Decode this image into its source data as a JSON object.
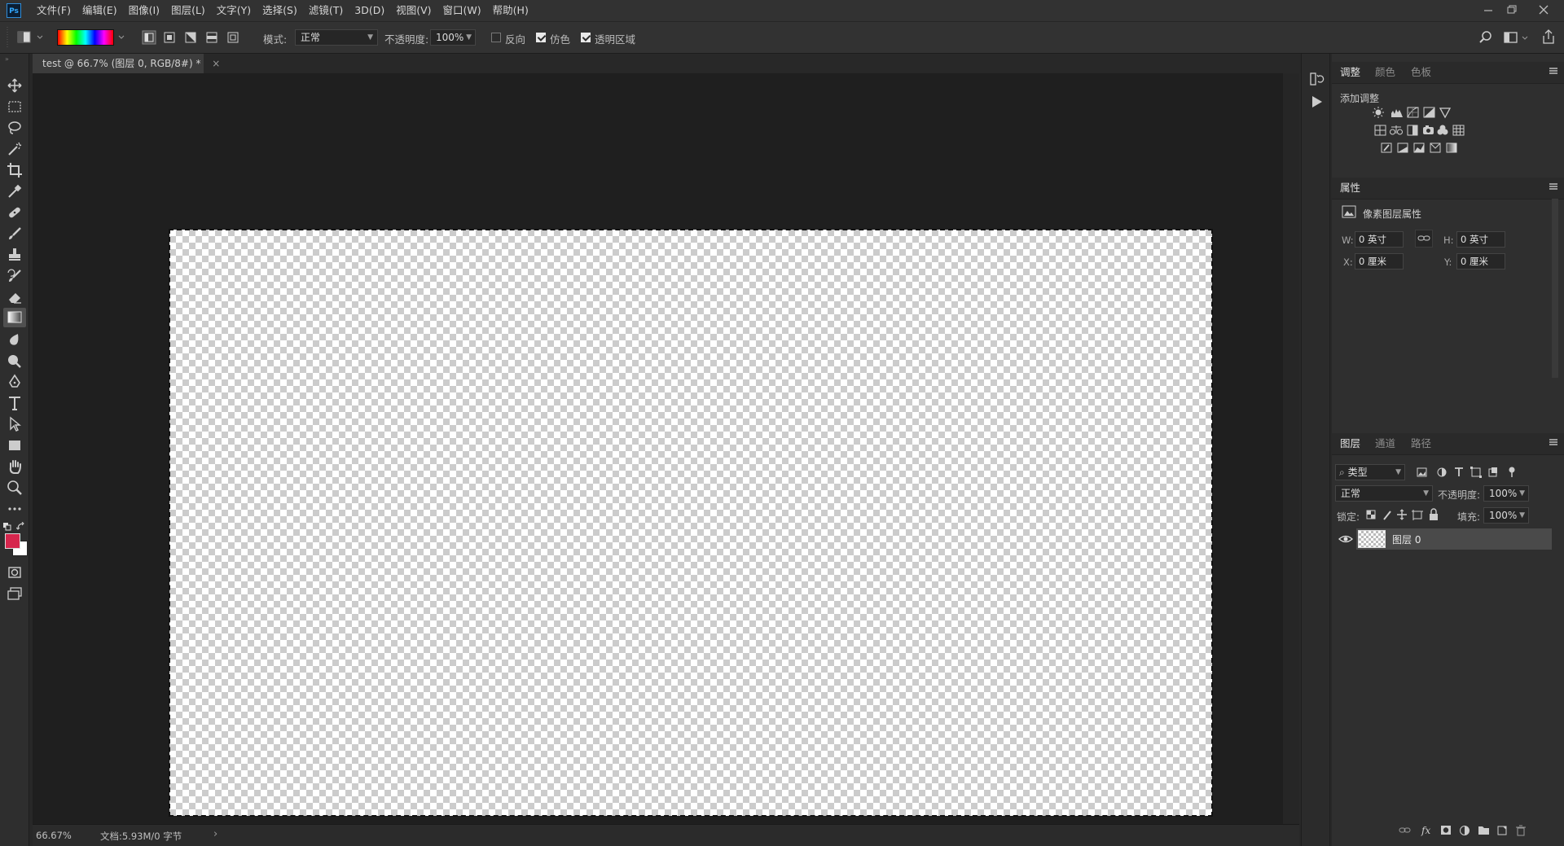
{
  "app": {
    "logo": "Ps",
    "menu": [
      "文件(F)",
      "编辑(E)",
      "图像(I)",
      "图层(L)",
      "文字(Y)",
      "选择(S)",
      "滤镜(T)",
      "3D(D)",
      "视图(V)",
      "窗口(W)",
      "帮助(H)"
    ]
  },
  "options_bar": {
    "mode_label": "模式:",
    "mode_value": "正常",
    "opacity_label": "不透明度:",
    "opacity_value": "100%",
    "reverse_label": "反向",
    "reverse_checked": false,
    "dither_label": "仿色",
    "dither_checked": true,
    "transparency_label": "透明区域",
    "transparency_checked": true
  },
  "document": {
    "tab_title": "test @ 66.7% (图层 0, RGB/8#) *",
    "close_glyph": "×",
    "zoom": "66.67%",
    "doc_info": "文档:5.93M/0 字节",
    "status_arrow": "›"
  },
  "colors": {
    "foreground": "#d6264d",
    "background": "#ffffff",
    "gradient_preview": [
      "#ff0000",
      "#ffff00",
      "#00ff00",
      "#00ffff",
      "#0000ff",
      "#ff00ff",
      "#ff0000"
    ]
  },
  "tools": [
    "move-tool",
    "marquee-tool",
    "lasso-tool",
    "magic-wand-tool",
    "crop-tool",
    "eyedropper-tool",
    "healing-brush-tool",
    "brush-tool",
    "clone-stamp-tool",
    "history-brush-tool",
    "eraser-tool",
    "gradient-tool",
    "blur-tool",
    "dodge-tool",
    "pen-tool",
    "type-tool",
    "path-selection-tool",
    "rectangle-tool",
    "hand-tool",
    "zoom-tool",
    "more-tools"
  ],
  "adjustments_panel": {
    "tabs": [
      "调整",
      "颜色",
      "色板"
    ],
    "active_tab": 0,
    "heading": "添加调整"
  },
  "properties_panel": {
    "title": "属性",
    "subtitle": "像素图层属性",
    "w_label": "W:",
    "w_value": "0 英寸",
    "h_label": "H:",
    "h_value": "0 英寸",
    "x_label": "X:",
    "x_value": "0 厘米",
    "y_label": "Y:",
    "y_value": "0 厘米"
  },
  "layers_panel": {
    "tabs": [
      "图层",
      "通道",
      "路径"
    ],
    "active_tab": 0,
    "filter_label": "类型",
    "blend_mode": "正常",
    "opacity_label": "不透明度:",
    "opacity_value": "100%",
    "lock_label": "锁定:",
    "fill_label": "填充:",
    "fill_value": "100%",
    "layers": [
      {
        "name": "图层 0",
        "visible": true
      }
    ]
  }
}
